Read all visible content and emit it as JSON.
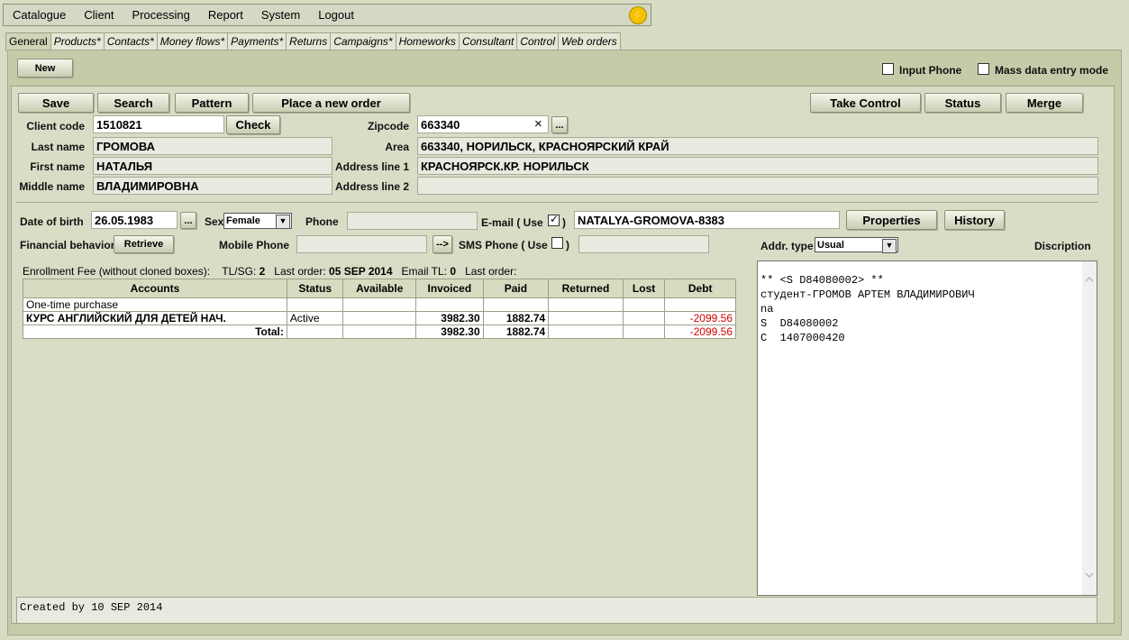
{
  "menu": [
    "Catalogue",
    "Client",
    "Processing",
    "Report",
    "System",
    "Logout"
  ],
  "tabs": [
    "General",
    "Products*",
    "Contacts*",
    "Money flows*",
    "Payments*",
    "Returns",
    "Campaigns*",
    "Homeworks",
    "Consultant",
    "Control",
    "Web orders"
  ],
  "toolbar": {
    "new": "New",
    "input_phone": "Input Phone",
    "mass_entry": "Mass data entry mode"
  },
  "actions": {
    "save": "Save",
    "search": "Search",
    "pattern": "Pattern",
    "place_order": "Place a new order",
    "take_control": "Take Control",
    "status": "Status",
    "merge": "Merge"
  },
  "client": {
    "code_label": "Client code",
    "code": "1510821",
    "check": "Check",
    "last_label": "Last name",
    "last": "ГРОМОВА",
    "first_label": "First name",
    "first": "НАТАЛЬЯ",
    "middle_label": "Middle name",
    "middle": "ВЛАДИМИРОВНА"
  },
  "address": {
    "zip_label": "Zipcode",
    "zip": "663340",
    "clear": "×",
    "browse": "...",
    "area_label": "Area",
    "area": "663340,  НОРИЛЬСК,  КРАСНОЯРСКИЙ КРАЙ",
    "line1_label": "Address line 1",
    "line1": "КРАСНОЯРСК.КР. НОРИЛЬСК",
    "line2_label": "Address line 2",
    "line2": ""
  },
  "contact": {
    "dob_label": "Date of birth",
    "dob": "26.05.1983",
    "dob_btn": "...",
    "sex_label": "Sex",
    "sex": "Female",
    "phone_label": "Phone",
    "phone": "",
    "email_label": "E-mail ( Use",
    "email_close": ")",
    "email": "NATALYA-GROMOVA-8383",
    "properties": "Properties",
    "history": "History",
    "fin_label": "Financial behavior",
    "retrieve": "Retrieve",
    "mobile_label": "Mobile Phone",
    "mobile": "",
    "arrow": "-->",
    "sms_label": "SMS Phone ( Use",
    "sms_close": ")",
    "sms": "",
    "addr_type_label": "Addr. type",
    "addr_type": "Usual",
    "description_label": "Discription"
  },
  "summary": {
    "enroll": "Enrollment Fee (without cloned boxes):",
    "tl_label": "TL/SG:",
    "tl": "2",
    "last_order_label": "Last order:",
    "last_order": "05 SEP 2014",
    "email_tl_label": "Email TL:",
    "email_tl": "0",
    "last_order2_label": "Last order:"
  },
  "accounts": {
    "headers": [
      "Accounts",
      "Status",
      "Available",
      "Invoiced",
      "Paid",
      "Returned",
      "Lost",
      "Debt"
    ],
    "rows": [
      [
        "One-time purchase",
        "",
        "",
        "",
        "",
        "",
        "",
        ""
      ],
      [
        "КУРС АНГЛИЙСКИЙ ДЛЯ ДЕТЕЙ НАЧ.",
        "Active",
        "",
        "3982.30",
        "1882.74",
        "",
        "",
        "-2099.56"
      ]
    ],
    "total": [
      "Total:",
      "",
      "",
      "3982.30",
      "1882.74",
      "",
      "",
      "-2099.56"
    ]
  },
  "description": [
    "** <S D84080002> **",
    "студент-ГРОМОВ АРТЕМ ВЛАДИМИРОВИЧ",
    "na",
    "S  D84080002",
    "C  1407000420"
  ],
  "footer": "Created by 10 SEP 2014",
  "colors": {
    "negative": "#d10000",
    "background": "#d7dcc3"
  }
}
